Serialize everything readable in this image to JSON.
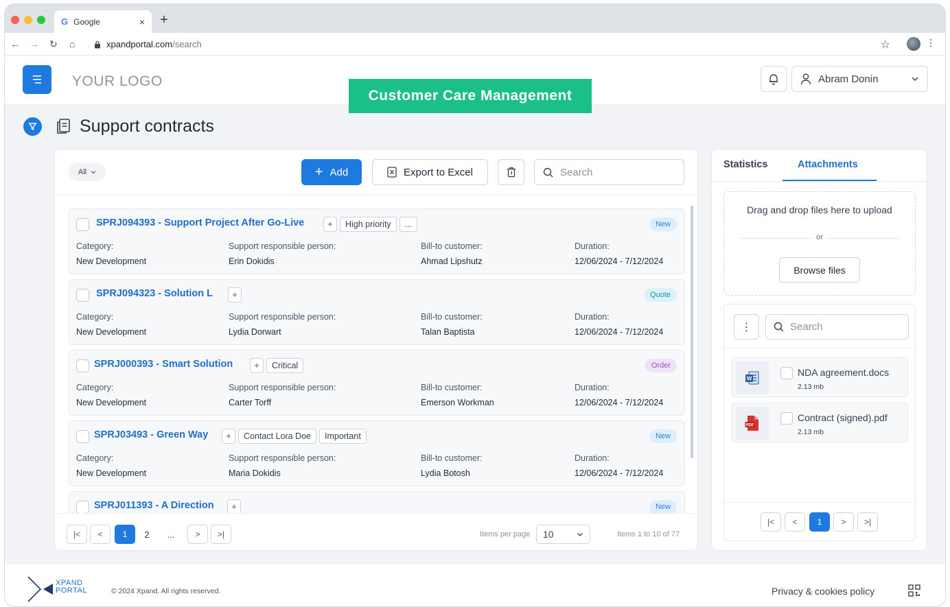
{
  "browser": {
    "tab_title": "Google",
    "tab_icon": "G",
    "url_host": "xpandportal.com",
    "url_path": "/search",
    "traffic_colors": [
      "#fe5f57",
      "#febc2e",
      "#28c840"
    ]
  },
  "header": {
    "logo": "YOUR LOGO",
    "user_name": "Abram Donin"
  },
  "banner": "Customer Care Management",
  "page": {
    "title": "Support contracts"
  },
  "toolbar": {
    "filter_label": "All",
    "add_label": "Add",
    "export_label": "Export to Excel",
    "search_placeholder": "Search"
  },
  "labels": {
    "category": "Category:",
    "responsible": "Support responsible person:",
    "customer": "Bill-to customer:",
    "duration": "Duration:"
  },
  "contracts": [
    {
      "title": "SPRJ094393 - Support Project After Go-Live",
      "tags": [
        "High priority",
        "..."
      ],
      "status": "New",
      "category": "New Development",
      "responsible": "Erin Dokidis",
      "customer": "Ahmad Lipshutz",
      "duration": "12/06/2024 - 7/12/2024"
    },
    {
      "title": "SPRJ094323 - Solution L",
      "tags": [],
      "status": "Quote",
      "category": "New Development",
      "responsible": "Lydia Dorwart",
      "customer": "Talan Baptista",
      "duration": "12/06/2024 - 7/12/2024"
    },
    {
      "title": "SPRJ000393 - Smart Solution",
      "tags": [
        "Critical"
      ],
      "status": "Order",
      "category": "New Development",
      "responsible": "Carter Torff",
      "customer": "Emerson Workman",
      "duration": "12/06/2024 - 7/12/2024"
    },
    {
      "title": "SPRJ03493 - Green Way",
      "tags": [
        "Contact Lora Doe",
        "Important"
      ],
      "status": "New",
      "category": "New Development",
      "responsible": "Maria Dokidis",
      "customer": "Lydia Botosh",
      "duration": "12/06/2024 - 7/12/2024"
    },
    {
      "title": "SPRJ011393 - A Direction",
      "tags": [],
      "status": "New"
    }
  ],
  "pagination": {
    "pages": [
      "1",
      "2",
      "..."
    ],
    "current_page": "1",
    "items_per_page_label": "Items per page",
    "items_per_page": "10",
    "items_info": "Items 1 to 10 of 77"
  },
  "side": {
    "tab_statistics": "Statistics",
    "tab_attachments": "Attachments",
    "drop_text": "Drag and drop files here to upload",
    "or_text": "or",
    "browse_label": "Browse files",
    "search_placeholder": "Search",
    "files": [
      {
        "name": "NDA agreement.docs",
        "size": "2.13 mb",
        "icon": "word-icon"
      },
      {
        "name": "Contract (signed).pdf",
        "size": "2.13 mb",
        "icon": "pdf-icon"
      }
    ],
    "current_page": "1"
  },
  "footer": {
    "brand_line1": "XPAND",
    "brand_line2": "PORTAL",
    "copyright": "© 2024 Xpand. All rights reserved.",
    "privacy": "Privacy & cookies policy"
  },
  "colors": {
    "primary": "#1f7ae0",
    "banner": "#1bbf8a",
    "link": "#1f6fc9",
    "status_new": "#2f7fd6",
    "status_quote": "#1690a6",
    "status_order": "#9b4fc4"
  }
}
